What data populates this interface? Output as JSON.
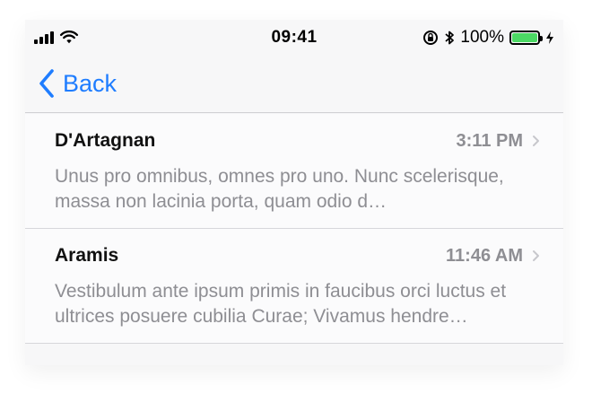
{
  "status_bar": {
    "time": "09:41",
    "battery_percent_text": "100%",
    "battery_level": 1.0,
    "icons": [
      "cellular-signal-icon",
      "wifi-icon",
      "rotation-lock-icon",
      "bluetooth-icon",
      "battery-icon",
      "charging-bolt-icon"
    ]
  },
  "nav": {
    "back_label": "Back",
    "accent_color": "#1f7dff"
  },
  "messages": [
    {
      "name": "D'Artagnan",
      "time": "3:11 PM",
      "preview": "Unus pro omnibus, omnes pro uno. Nunc scelerisque, massa non lacinia porta, quam odio d…"
    },
    {
      "name": "Aramis",
      "time": "11:46 AM",
      "preview": "Vestibulum ante ipsum primis in faucibus orci luctus et ultrices posuere cubilia Curae; Vivamus hendre…"
    }
  ]
}
